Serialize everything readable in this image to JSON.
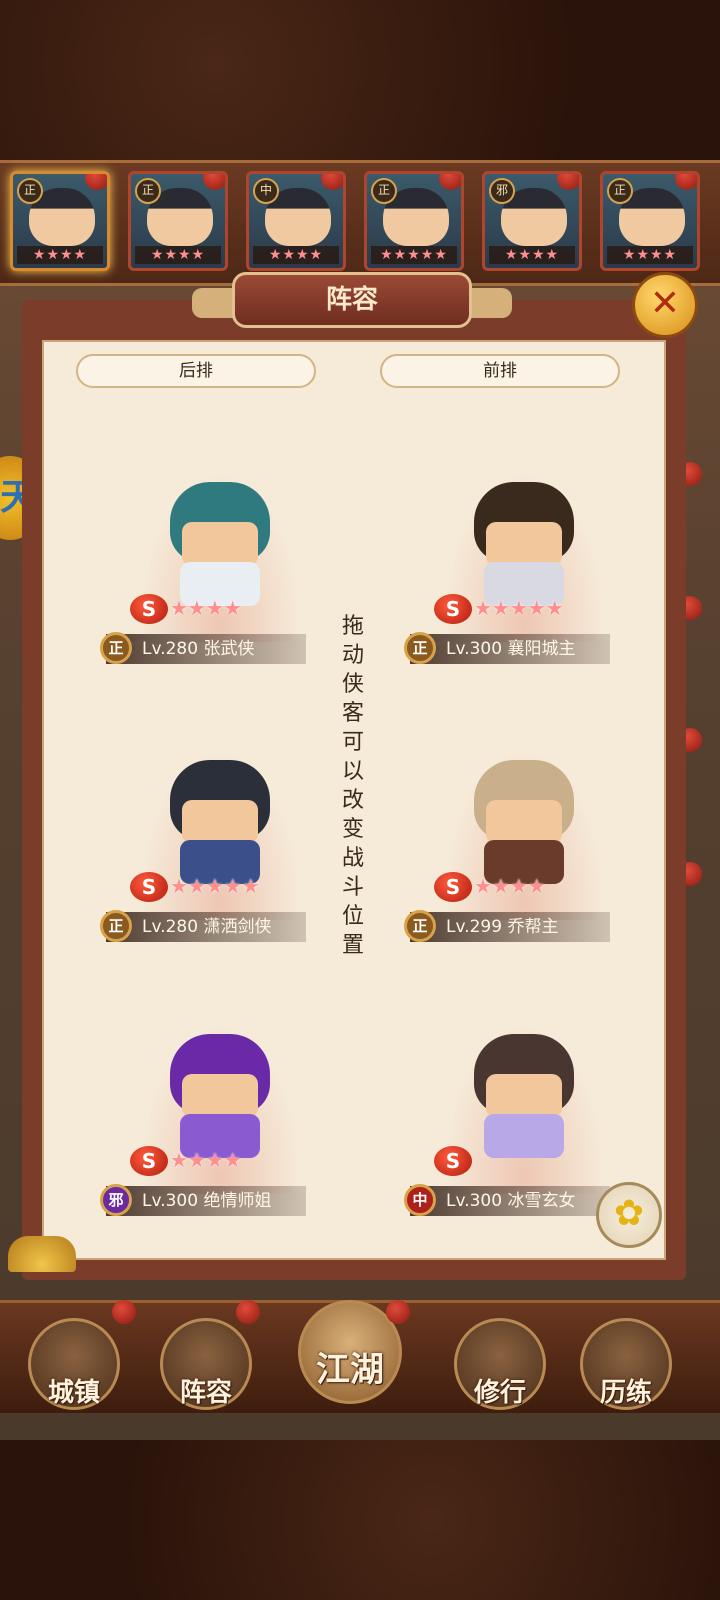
{
  "hero_strip": [
    {
      "faction": "正",
      "stars": "★★★★"
    },
    {
      "faction": "正",
      "stars": "★★★★"
    },
    {
      "faction": "中",
      "stars": "★★★★"
    },
    {
      "faction": "正",
      "stars": "★★★★★"
    },
    {
      "faction": "邪",
      "stars": "★★★★"
    },
    {
      "faction": "正",
      "stars": "★★★★"
    }
  ],
  "panel": {
    "title": "阵容",
    "back_row_label": "后排",
    "front_row_label": "前排",
    "hint": "拖动侠客可以改变战斗位置",
    "close_icon": "✕"
  },
  "slots": [
    {
      "id": "back-1",
      "faction": "正",
      "faction_color": "#8a5a1e",
      "level": "Lv.280",
      "name": "张武侠",
      "stars": "★★★★",
      "hair": "#2f7a7e",
      "body": "#e9eef3"
    },
    {
      "id": "front-1",
      "faction": "正",
      "faction_color": "#8a5a1e",
      "level": "Lv.300",
      "name": "襄阳城主",
      "stars": "★★★★★",
      "hair": "#3a2a1e",
      "body": "#d9d9e3"
    },
    {
      "id": "back-2",
      "faction": "正",
      "faction_color": "#8a5a1e",
      "level": "Lv.280",
      "name": "潇洒剑侠",
      "stars": "★★★★★",
      "hair": "#2a2f3a",
      "body": "#3b4f8a"
    },
    {
      "id": "front-2",
      "faction": "正",
      "faction_color": "#8a5a1e",
      "level": "Lv.299",
      "name": "乔帮主",
      "stars": "★★★★",
      "hair": "#c9b08a",
      "body": "#6a3a2a"
    },
    {
      "id": "back-3",
      "faction": "邪",
      "faction_color": "#6a2aa0",
      "level": "Lv.300",
      "name": "绝情师姐",
      "stars": "★★★★",
      "hair": "#6a2aa8",
      "body": "#8a5ad0"
    },
    {
      "id": "front-3",
      "faction": "中",
      "faction_color": "#b0201a",
      "level": "Lv.300",
      "name": "冰雪玄女",
      "stars": "",
      "hair": "#4a3630",
      "body": "#b9a8e8"
    }
  ],
  "nav": [
    {
      "label": "城镇"
    },
    {
      "label": "阵容"
    },
    {
      "label": "江湖"
    },
    {
      "label": "修行"
    },
    {
      "label": "历练"
    }
  ],
  "side_token": "天",
  "flower_icon": "✿"
}
